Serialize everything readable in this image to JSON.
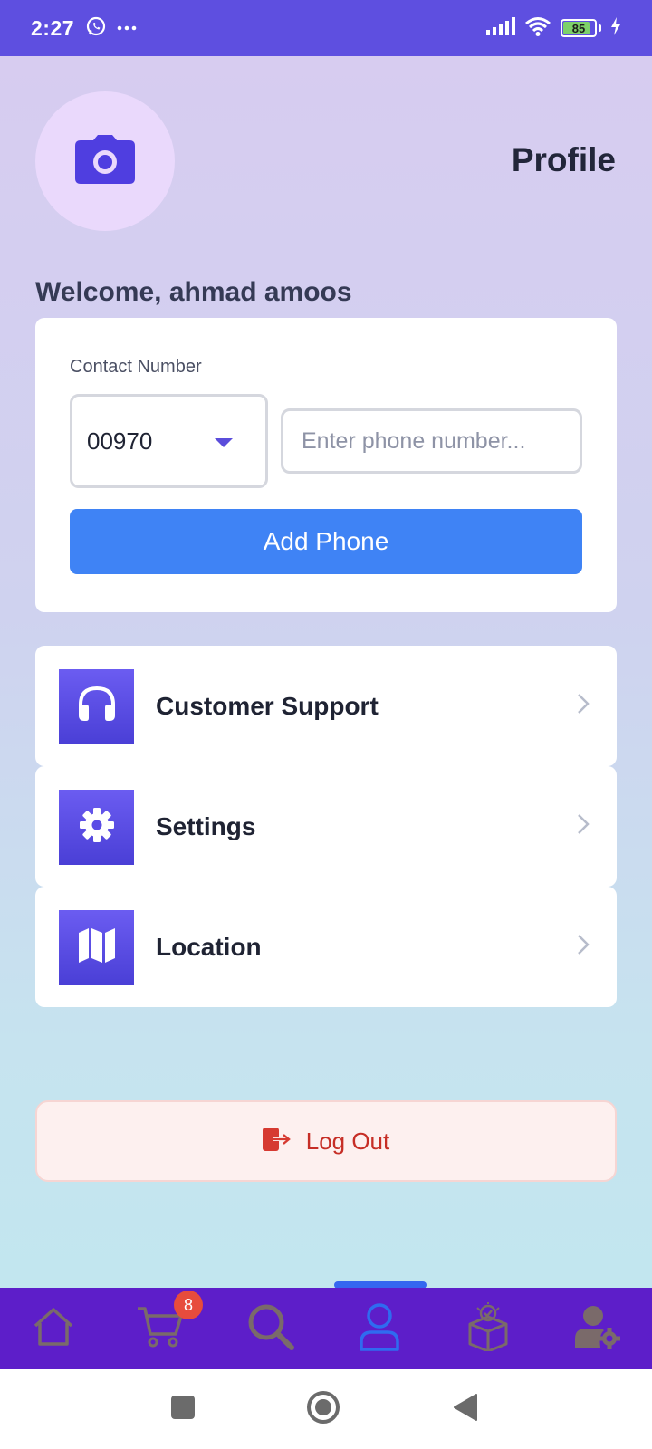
{
  "status_bar": {
    "time": "2:27",
    "battery_level": "85",
    "battery_fraction": 0.85,
    "icons": [
      "whatsapp-icon",
      "more-dots-icon",
      "signal-icon",
      "wifi-icon",
      "battery-icon",
      "charging-icon"
    ]
  },
  "header": {
    "title": "Profile",
    "avatar_icon": "camera-icon"
  },
  "welcome_text": "Welcome, ahmad amoos",
  "contact": {
    "label": "Contact Number",
    "country_code": "00970",
    "phone_value": "",
    "phone_placeholder": "Enter phone number...",
    "add_button": "Add Phone"
  },
  "menu": {
    "items": [
      {
        "label": "Customer Support",
        "icon": "headphones-icon"
      },
      {
        "label": "Settings",
        "icon": "gear-icon"
      },
      {
        "label": "Location",
        "icon": "map-icon"
      }
    ]
  },
  "logout": {
    "label": "Log Out",
    "icon": "logout-icon"
  },
  "bottom_nav": {
    "items": [
      "home-icon",
      "cart-icon",
      "search-icon",
      "profile-icon",
      "box-check-icon",
      "user-settings-icon"
    ],
    "active": "profile-icon",
    "cart_badge": "8"
  },
  "colors": {
    "status_bar": "#5e4fe0",
    "primary_button": "#3f83f5",
    "bottom_nav": "#5d1ec9",
    "logout_text": "#c62e26",
    "active_nav": "#3467f0"
  }
}
